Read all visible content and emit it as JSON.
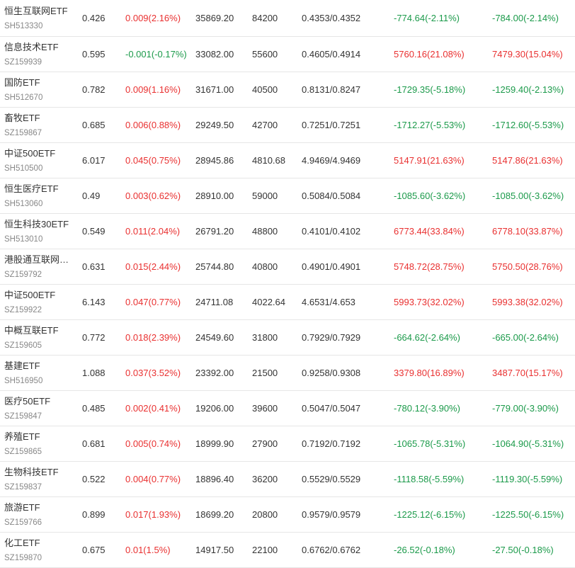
{
  "colors": {
    "up": "#e93030",
    "down": "#1b9a4a",
    "text": "#333333",
    "code": "#888888"
  },
  "rows": [
    {
      "name": "恒生互联网ETF",
      "code": "SH513330",
      "price": "0.426",
      "change": "0.009(2.16%)",
      "change_dir": "up",
      "amount": "35869.20",
      "volume": "84200",
      "nav": "0.4353/0.4352",
      "p1": "-774.64(-2.11%)",
      "p1_dir": "down",
      "p2": "-784.00(-2.14%)",
      "p2_dir": "down"
    },
    {
      "name": "信息技术ETF",
      "code": "SZ159939",
      "price": "0.595",
      "change": "-0.001(-0.17%)",
      "change_dir": "down",
      "amount": "33082.00",
      "volume": "55600",
      "nav": "0.4605/0.4914",
      "p1": "5760.16(21.08%)",
      "p1_dir": "up",
      "p2": "7479.30(15.04%)",
      "p2_dir": "up"
    },
    {
      "name": "国防ETF",
      "code": "SH512670",
      "price": "0.782",
      "change": "0.009(1.16%)",
      "change_dir": "up",
      "amount": "31671.00",
      "volume": "40500",
      "nav": "0.8131/0.8247",
      "p1": "-1729.35(-5.18%)",
      "p1_dir": "down",
      "p2": "-1259.40(-2.13%)",
      "p2_dir": "down"
    },
    {
      "name": "畜牧ETF",
      "code": "SZ159867",
      "price": "0.685",
      "change": "0.006(0.88%)",
      "change_dir": "up",
      "amount": "29249.50",
      "volume": "42700",
      "nav": "0.7251/0.7251",
      "p1": "-1712.27(-5.53%)",
      "p1_dir": "down",
      "p2": "-1712.60(-5.53%)",
      "p2_dir": "down"
    },
    {
      "name": "中证500ETF",
      "code": "SH510500",
      "price": "6.017",
      "change": "0.045(0.75%)",
      "change_dir": "up",
      "amount": "28945.86",
      "volume": "4810.68",
      "nav": "4.9469/4.9469",
      "p1": "5147.91(21.63%)",
      "p1_dir": "up",
      "p2": "5147.86(21.63%)",
      "p2_dir": "up"
    },
    {
      "name": "恒生医疗ETF",
      "code": "SH513060",
      "price": "0.49",
      "change": "0.003(0.62%)",
      "change_dir": "up",
      "amount": "28910.00",
      "volume": "59000",
      "nav": "0.5084/0.5084",
      "p1": "-1085.60(-3.62%)",
      "p1_dir": "down",
      "p2": "-1085.00(-3.62%)",
      "p2_dir": "down"
    },
    {
      "name": "恒生科技30ETF",
      "code": "SH513010",
      "price": "0.549",
      "change": "0.011(2.04%)",
      "change_dir": "up",
      "amount": "26791.20",
      "volume": "48800",
      "nav": "0.4101/0.4102",
      "p1": "6773.44(33.84%)",
      "p1_dir": "up",
      "p2": "6778.10(33.87%)",
      "p2_dir": "up"
    },
    {
      "name": "港股通互联网…",
      "code": "SZ159792",
      "price": "0.631",
      "change": "0.015(2.44%)",
      "change_dir": "up",
      "amount": "25744.80",
      "volume": "40800",
      "nav": "0.4901/0.4901",
      "p1": "5748.72(28.75%)",
      "p1_dir": "up",
      "p2": "5750.50(28.76%)",
      "p2_dir": "up"
    },
    {
      "name": "中证500ETF",
      "code": "SZ159922",
      "price": "6.143",
      "change": "0.047(0.77%)",
      "change_dir": "up",
      "amount": "24711.08",
      "volume": "4022.64",
      "nav": "4.6531/4.653",
      "p1": "5993.73(32.02%)",
      "p1_dir": "up",
      "p2": "5993.38(32.02%)",
      "p2_dir": "up"
    },
    {
      "name": "中概互联ETF",
      "code": "SZ159605",
      "price": "0.772",
      "change": "0.018(2.39%)",
      "change_dir": "up",
      "amount": "24549.60",
      "volume": "31800",
      "nav": "0.7929/0.7929",
      "p1": "-664.62(-2.64%)",
      "p1_dir": "down",
      "p2": "-665.00(-2.64%)",
      "p2_dir": "down"
    },
    {
      "name": "基建ETF",
      "code": "SH516950",
      "price": "1.088",
      "change": "0.037(3.52%)",
      "change_dir": "up",
      "amount": "23392.00",
      "volume": "21500",
      "nav": "0.9258/0.9308",
      "p1": "3379.80(16.89%)",
      "p1_dir": "up",
      "p2": "3487.70(15.17%)",
      "p2_dir": "up"
    },
    {
      "name": "医疗50ETF",
      "code": "SZ159847",
      "price": "0.485",
      "change": "0.002(0.41%)",
      "change_dir": "up",
      "amount": "19206.00",
      "volume": "39600",
      "nav": "0.5047/0.5047",
      "p1": "-780.12(-3.90%)",
      "p1_dir": "down",
      "p2": "-779.00(-3.90%)",
      "p2_dir": "down"
    },
    {
      "name": "养殖ETF",
      "code": "SZ159865",
      "price": "0.681",
      "change": "0.005(0.74%)",
      "change_dir": "up",
      "amount": "18999.90",
      "volume": "27900",
      "nav": "0.7192/0.7192",
      "p1": "-1065.78(-5.31%)",
      "p1_dir": "down",
      "p2": "-1064.90(-5.31%)",
      "p2_dir": "down"
    },
    {
      "name": "生物科技ETF",
      "code": "SZ159837",
      "price": "0.522",
      "change": "0.004(0.77%)",
      "change_dir": "up",
      "amount": "18896.40",
      "volume": "36200",
      "nav": "0.5529/0.5529",
      "p1": "-1118.58(-5.59%)",
      "p1_dir": "down",
      "p2": "-1119.30(-5.59%)",
      "p2_dir": "down"
    },
    {
      "name": "旅游ETF",
      "code": "SZ159766",
      "price": "0.899",
      "change": "0.017(1.93%)",
      "change_dir": "up",
      "amount": "18699.20",
      "volume": "20800",
      "nav": "0.9579/0.9579",
      "p1": "-1225.12(-6.15%)",
      "p1_dir": "down",
      "p2": "-1225.50(-6.15%)",
      "p2_dir": "down"
    },
    {
      "name": "化工ETF",
      "code": "SZ159870",
      "price": "0.675",
      "change": "0.01(1.5%)",
      "change_dir": "up",
      "amount": "14917.50",
      "volume": "22100",
      "nav": "0.6762/0.6762",
      "p1": "-26.52(-0.18%)",
      "p1_dir": "down",
      "p2": "-27.50(-0.18%)",
      "p2_dir": "down"
    }
  ]
}
